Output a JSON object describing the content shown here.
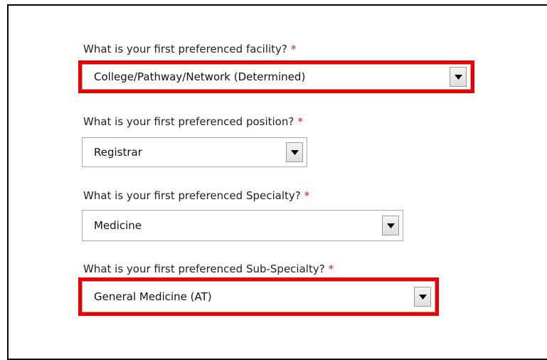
{
  "form": {
    "fields": [
      {
        "label": "What is your first preferenced facility?",
        "required_mark": "*",
        "value": "College/Pathway/Network (Determined)",
        "highlighted": true
      },
      {
        "label": "What is your first preferenced position?",
        "required_mark": "*",
        "value": "Registrar",
        "highlighted": false
      },
      {
        "label": "What is your first preferenced Specialty?",
        "required_mark": "*",
        "value": "Medicine",
        "highlighted": false
      },
      {
        "label": "What is your first preferenced Sub-Specialty?",
        "required_mark": "*",
        "value": "General Medicine (AT)",
        "highlighted": true
      }
    ]
  },
  "colors": {
    "highlight": "#ee0000",
    "required": "#cc2222"
  },
  "icons": {
    "dropdown": "triangle-down-icon"
  }
}
